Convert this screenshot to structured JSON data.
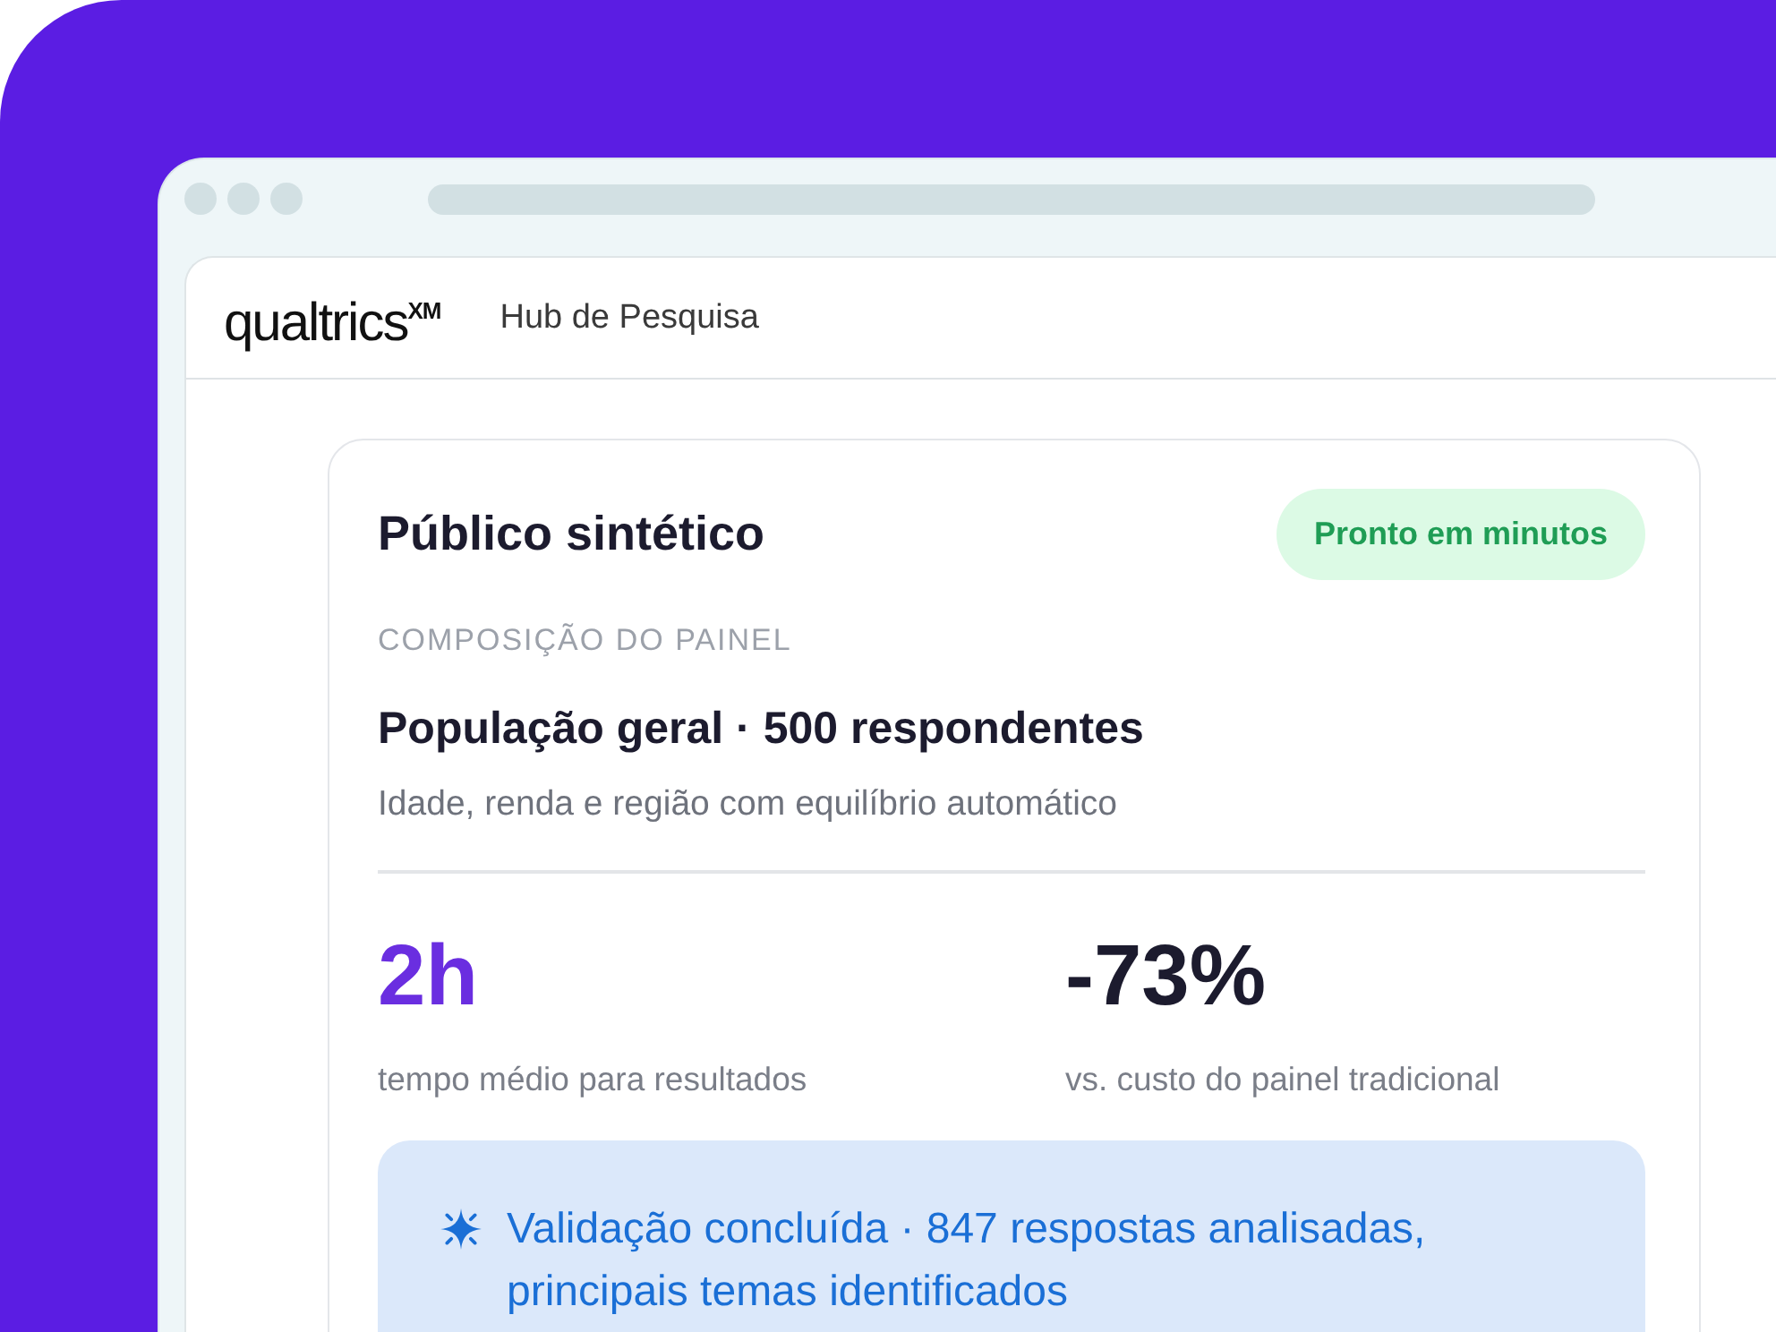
{
  "header": {
    "logo": "qualtrics$^{XM}$",
    "title": "Hub de Pesquisa"
  },
  "card": {
    "title": "Público sintético",
    "badge": "Pronto em minutos",
    "section_label": "COMPOSIÇÃO DO PAINEL",
    "headline": "População geral · 500 respondentes",
    "description": "Idade, renda e região com equilíbrio automático",
    "stats": [
      {
        "value": "2h",
        "label": "tempo médio para resultados",
        "color": "#6a2ee0"
      },
      {
        "value": "-73%",
        "label": "vs. custo do painel tradicional",
        "color": "#1c1b2e"
      }
    ],
    "notice": {
      "text": "Validação concluída · 847 respostas analisadas, principais temas identificados"
    }
  }
}
